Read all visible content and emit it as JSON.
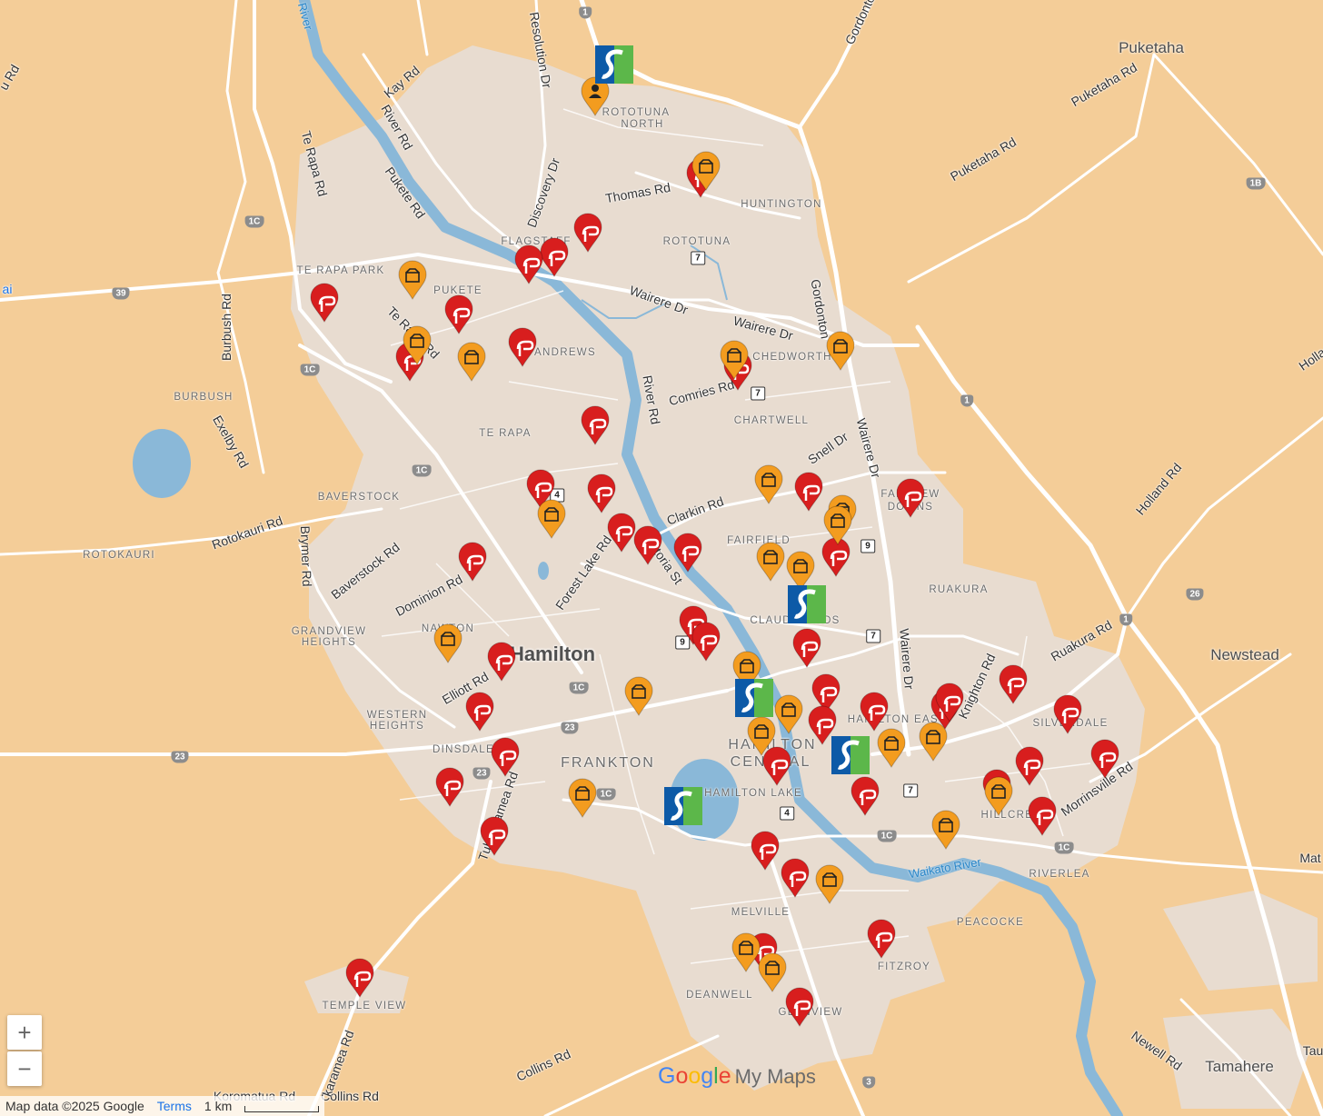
{
  "map": {
    "city_label": "Hamilton",
    "town_labels": [
      {
        "id": "puketaha",
        "text": "Puketaha"
      },
      {
        "id": "newstead",
        "text": "Newstead"
      },
      {
        "id": "tamahere",
        "text": "Tamahere"
      }
    ],
    "suburb_labels": [
      {
        "id": "rototuna-north-1",
        "text": "ROTOTUNA"
      },
      {
        "id": "rototuna-north-2",
        "text": "NORTH"
      },
      {
        "id": "huntington",
        "text": "HUNTINGTON"
      },
      {
        "id": "rototuna",
        "text": "ROTOTUNA"
      },
      {
        "id": "flagstaff",
        "text": "FLAGSTAFF"
      },
      {
        "id": "te-rapa-park",
        "text": "TE RAPA PARK"
      },
      {
        "id": "pukete",
        "text": "PUKETE"
      },
      {
        "id": "st-andrews",
        "text": "ANDREWS"
      },
      {
        "id": "chedworth",
        "text": "CHEDWORTH"
      },
      {
        "id": "burbush",
        "text": "BURBUSH"
      },
      {
        "id": "te-rapa",
        "text": "TE RAPA"
      },
      {
        "id": "chartwell",
        "text": "CHARTWELL"
      },
      {
        "id": "baverstock",
        "text": "BAVERSTOCK"
      },
      {
        "id": "fairview-downs-1",
        "text": "FAIRVIEW"
      },
      {
        "id": "fairview-downs-2",
        "text": "DOWNS"
      },
      {
        "id": "rotokauri",
        "text": "ROTOKAURI"
      },
      {
        "id": "fairfield",
        "text": "FAIRFIELD"
      },
      {
        "id": "ruakura",
        "text": "RUAKURA"
      },
      {
        "id": "claudelands",
        "text": "CLAUDELANDS"
      },
      {
        "id": "grandview-1",
        "text": "GRANDVIEW"
      },
      {
        "id": "grandview-2",
        "text": "HEIGHTS"
      },
      {
        "id": "nawton",
        "text": "NAWTON"
      },
      {
        "id": "western-1",
        "text": "WESTERN"
      },
      {
        "id": "western-2",
        "text": "HEIGHTS"
      },
      {
        "id": "hamilton-east",
        "text": "HAMILTON EAST"
      },
      {
        "id": "silverdale",
        "text": "SILVERDALE"
      },
      {
        "id": "dinsdale",
        "text": "DINSDALE"
      },
      {
        "id": "frankton",
        "text": "FRANKTON"
      },
      {
        "id": "hamilton-central-1",
        "text": "HAMILTON"
      },
      {
        "id": "hamilton-central-2",
        "text": "CENTRAL"
      },
      {
        "id": "hamilton-lake",
        "text": "HAMILTON LAKE"
      },
      {
        "id": "hillcrest",
        "text": "HILLCREST"
      },
      {
        "id": "riverlea",
        "text": "RIVERLEA"
      },
      {
        "id": "melville",
        "text": "MELVILLE"
      },
      {
        "id": "peacocke",
        "text": "PEACOCKE"
      },
      {
        "id": "fitzroy",
        "text": "FITZROY"
      },
      {
        "id": "deanwell",
        "text": "DEANWELL"
      },
      {
        "id": "glenview",
        "text": "GLENVIEW"
      },
      {
        "id": "temple-view",
        "text": "TEMPLE VIEW"
      }
    ],
    "road_labels": [
      {
        "id": "resolution-dr",
        "text": "Resolution Dr"
      },
      {
        "id": "kay-rd",
        "text": "Kay Rd"
      },
      {
        "id": "river-rd-n",
        "text": "River Rd"
      },
      {
        "id": "gordonton-n",
        "text": "Gordonton"
      },
      {
        "id": "puketaha-rd-1",
        "text": "Puketaha Rd"
      },
      {
        "id": "puketaha-rd-2",
        "text": "Puketaha Rd"
      },
      {
        "id": "te-rapa-rd",
        "text": "Te Rapa Rd"
      },
      {
        "id": "pukete-rd",
        "text": "Pukete Rd"
      },
      {
        "id": "discovery-dr",
        "text": "Discovery Dr"
      },
      {
        "id": "thomas-rd",
        "text": "Thomas Rd"
      },
      {
        "id": "wairere-dr-1",
        "text": "Wairere Dr"
      },
      {
        "id": "wairere-dr-2",
        "text": "Wairere Dr"
      },
      {
        "id": "gordonton-rd",
        "text": "Gordonton"
      },
      {
        "id": "burbush-rd",
        "text": "Burbush Rd"
      },
      {
        "id": "te-rapa-rd-2",
        "text": "Te Rapa Rd"
      },
      {
        "id": "river-rd",
        "text": "River Rd"
      },
      {
        "id": "comries-rd",
        "text": "Comries Rd"
      },
      {
        "id": "exelby-rd",
        "text": "Exelby Rd"
      },
      {
        "id": "snell-dr",
        "text": "Snell Dr"
      },
      {
        "id": "wairere-dr-3",
        "text": "Wairere Dr"
      },
      {
        "id": "clarkin-rd",
        "text": "Clarkin Rd"
      },
      {
        "id": "holland-rd",
        "text": "Holland Rd"
      },
      {
        "id": "rotokauri-rd",
        "text": "Rotokauri Rd"
      },
      {
        "id": "brymer-rd",
        "text": "Brymer Rd"
      },
      {
        "id": "baverstock-rd",
        "text": "Baverstock Rd"
      },
      {
        "id": "forest-lake-rd",
        "text": "Forest Lake Rd"
      },
      {
        "id": "victoria-st",
        "text": "Victoria St"
      },
      {
        "id": "dominion-rd",
        "text": "Dominion Rd"
      },
      {
        "id": "wairere-dr-4",
        "text": "Wairere Dr"
      },
      {
        "id": "ruakura-rd",
        "text": "Ruakura Rd"
      },
      {
        "id": "knighton-rd",
        "text": "Knighton Rd"
      },
      {
        "id": "elliott-rd",
        "text": "Elliott Rd"
      },
      {
        "id": "morrinsville-rd",
        "text": "Morrinsville Rd"
      },
      {
        "id": "tuhikaramea-rd",
        "text": "Tuhikaramea Rd"
      },
      {
        "id": "collins-rd",
        "text": "Collins Rd"
      },
      {
        "id": "newell-rd",
        "text": "Newell Rd"
      },
      {
        "id": "koromatua-rd",
        "text": "Koromatua Rd"
      },
      {
        "id": "collins-rd-2",
        "text": "Collins Rd"
      },
      {
        "id": "karamea-rd",
        "text": "karamea Rd"
      }
    ],
    "river_labels": [
      {
        "id": "river-n",
        "text": "River"
      },
      {
        "id": "waikato-river",
        "text": "Waikato River"
      }
    ],
    "route_shields": [
      "1",
      "1C",
      "39",
      "1C",
      "1C",
      "1B",
      "1",
      "7",
      "7",
      "4",
      "9",
      "7",
      "9",
      "26",
      "1",
      "1C",
      "23",
      "23",
      "23",
      "1C",
      "4",
      "7",
      "1C",
      "1C",
      "3",
      "3"
    ],
    "edge_labels": [
      {
        "id": "edge-au",
        "text": "u Rd"
      },
      {
        "id": "edge-ai",
        "text": "ai"
      },
      {
        "id": "edge-holl",
        "text": "Holla"
      },
      {
        "id": "edge-mat",
        "text": "Mat"
      },
      {
        "id": "edge-tau",
        "text": "Tau"
      }
    ]
  },
  "markers": {
    "red_pin_icon": "red-swirl-pin-icon",
    "orange_pin_icon": "orange-basket-pin-icon",
    "logo_icon": "blue-green-s-logo-icon",
    "person_icon": "orange-person-pin-icon",
    "colors": {
      "red": "#d81e1e",
      "orange": "#f39c1f",
      "logo_blue": "#0d5aa7",
      "logo_green": "#5cb74a"
    }
  },
  "controls": {
    "zoom_in": "+",
    "zoom_out": "−"
  },
  "attribution": {
    "map_data": "Map data ©2025 Google",
    "terms": "Terms",
    "scale": "1 km"
  },
  "branding": {
    "google": "Google",
    "my_maps": "My Maps"
  }
}
